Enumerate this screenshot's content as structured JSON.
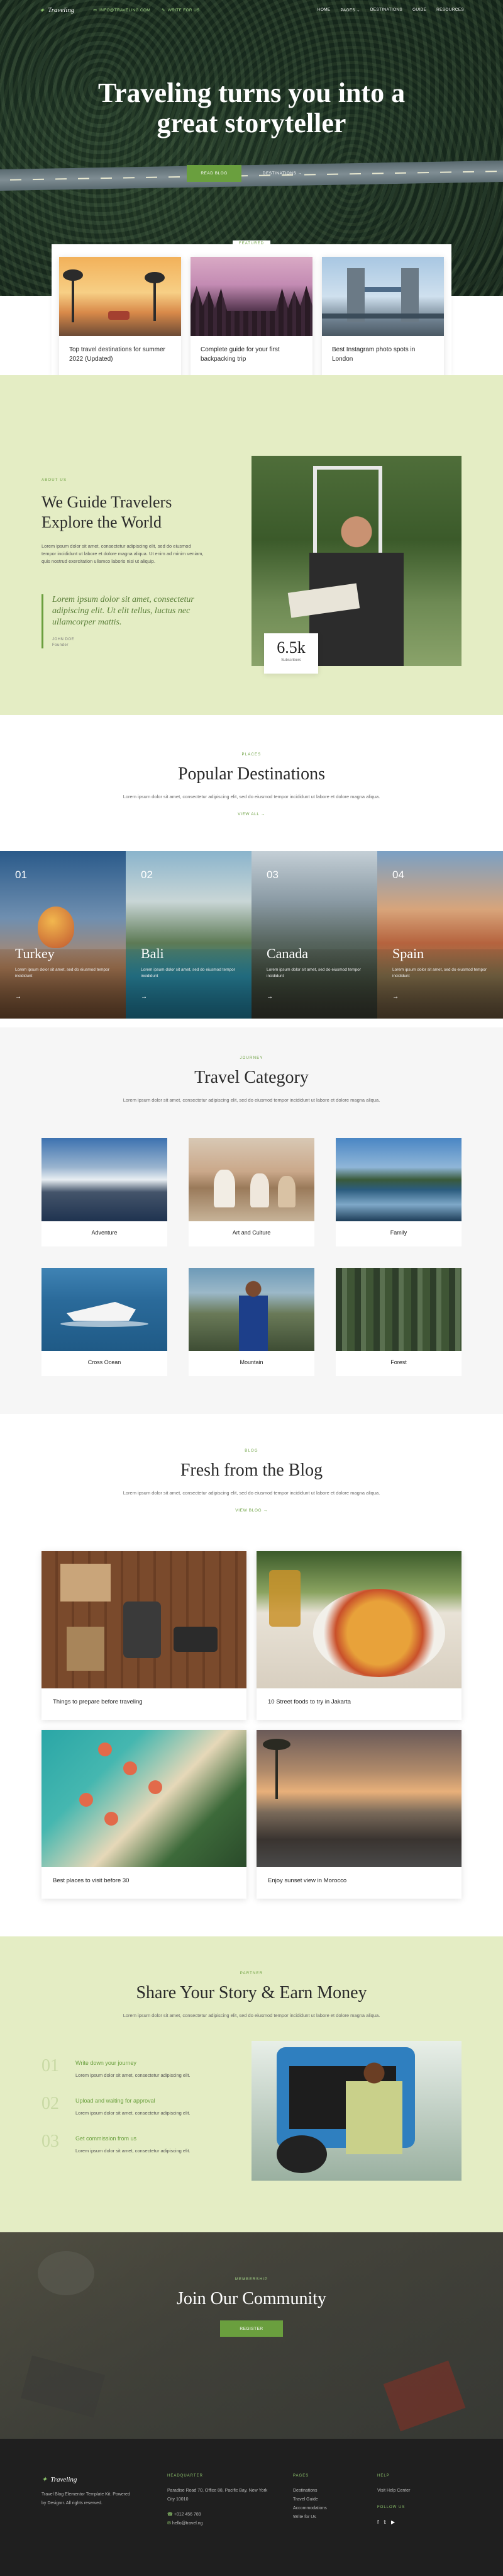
{
  "nav": {
    "logo": "Traveling",
    "email": "INFO@TRAVELING.COM",
    "cta": "WRITE FOR US",
    "menu": [
      "HOME",
      "PAGES",
      "DESTINATIONS",
      "GUIDE",
      "RESOURCES"
    ]
  },
  "hero": {
    "title_line1": "Traveling turns you into a",
    "title_line2": "great storyteller",
    "btn_primary": "READ BLOG",
    "btn_secondary": "DESTINATIONS",
    "featured_label": "FEATURED",
    "featured": [
      {
        "title": "Top travel destinations for summer 2022 (Updated)"
      },
      {
        "title": "Complete guide for your first backpacking trip"
      },
      {
        "title": "Best Instagram photo spots in London"
      }
    ]
  },
  "about": {
    "eyebrow": "ABOUT US",
    "title_line1": "We Guide Travelers",
    "title_line2": "Explore the World",
    "paragraph": "Lorem ipsum dolor sit amet, consectetur adipiscing elit, sed do eiusmod tempor incididunt ut labore et dolore magna aliqua. Ut enim ad minim veniam, quis nostrud exercitation ullamco laboris nisi ut aliquip.",
    "quote": "Lorem ipsum dolor sit amet, consectetur adipiscing elit. Ut elit tellus, luctus nec ullamcorper mattis.",
    "author": "JOHN DOE",
    "author_role": "Founder",
    "stat_number": "6.5k",
    "stat_label": "Subscribers"
  },
  "destinations": {
    "eyebrow": "PLACES",
    "title": "Popular Destinations",
    "subtitle": "Lorem ipsum dolor sit amet, consectetur adipiscing elit, sed do eiusmod tempor incididunt ut labore et dolore magna aliqua.",
    "link": "VIEW ALL",
    "items": [
      {
        "num": "01",
        "name": "Turkey",
        "desc": "Lorem ipsum dolor sit amet, sed do eiusmod tempor incididunt"
      },
      {
        "num": "02",
        "name": "Bali",
        "desc": "Lorem ipsum dolor sit amet, sed do eiusmod tempor incididunt"
      },
      {
        "num": "03",
        "name": "Canada",
        "desc": "Lorem ipsum dolor sit amet, sed do eiusmod tempor incididunt"
      },
      {
        "num": "04",
        "name": "Spain",
        "desc": "Lorem ipsum dolor sit amet, sed do eiusmod tempor incididunt"
      }
    ]
  },
  "category": {
    "eyebrow": "JOURNEY",
    "title": "Travel Category",
    "subtitle": "Lorem ipsum dolor sit amet, consectetur adipiscing elit, sed do eiusmod tempor incididunt ut labore et dolore magna aliqua.",
    "items": [
      "Adventure",
      "Art and Culture",
      "Family",
      "Cross Ocean",
      "Mountain",
      "Forest"
    ]
  },
  "blog": {
    "eyebrow": "BLOG",
    "title": "Fresh from the Blog",
    "subtitle": "Lorem ipsum dolor sit amet, consectetur adipiscing elit, sed do eiusmod tempor incididunt ut labore et dolore magna aliqua.",
    "link": "VIEW BLOG",
    "posts": [
      "Things to prepare before traveling",
      "10 Street foods to try in Jakarta",
      "Best places to visit before 30",
      "Enjoy sunset view in Morocco"
    ]
  },
  "share": {
    "eyebrow": "PARTNER",
    "title": "Share Your Story & Earn Money",
    "subtitle": "Lorem ipsum dolor sit amet, consectetur adipiscing elit, sed do eiusmod tempor incididunt ut labore et dolore magna aliqua.",
    "steps": [
      {
        "num": "01",
        "title": "Write down your journey",
        "desc": "Lorem ipsum dolor sit amet, consectetur adipiscing elit."
      },
      {
        "num": "02",
        "title": "Upload and waiting for approval",
        "desc": "Lorem ipsum dolor sit amet, consectetur adipiscing elit."
      },
      {
        "num": "03",
        "title": "Get commission from us",
        "desc": "Lorem ipsum dolor sit amet, consectetur adipiscing elit."
      }
    ]
  },
  "community": {
    "eyebrow": "MEMBERSHIP",
    "title": "Join Our Community",
    "button": "REGISTER"
  },
  "footer": {
    "logo": "Traveling",
    "tagline": "Travel Blog Elementor Template Kit. Powered by Designrr. All rights reserved.",
    "hq_label": "HEADQUARTER",
    "address": "Paradise Road 70, Office 88, Pacific Bay, New York City 10010",
    "phone": "+012 456 789",
    "email": "hello@travel.ng",
    "pages_label": "PAGES",
    "pages": [
      "Destinations",
      "Travel Guide",
      "Accommodations",
      "Write for Us"
    ],
    "help_label": "HELP",
    "help_link": "Visit Help Center",
    "follow_label": "FOLLOW US"
  },
  "colors": {
    "accent": "#6a9f3e",
    "mint": "#e4edc4",
    "dark": "#1f1f1f"
  }
}
